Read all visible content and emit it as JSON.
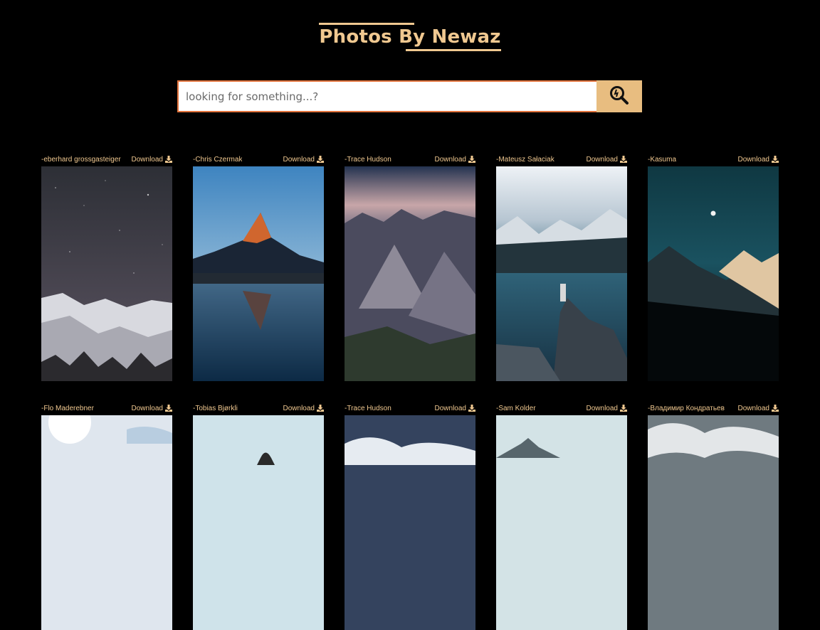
{
  "header": {
    "title": "Photos By Newaz"
  },
  "search": {
    "placeholder": "looking for something...?",
    "button_icon": "search-icon"
  },
  "photos": [
    {
      "author": "-eberhard grossgasteiger",
      "download_label": "Download"
    },
    {
      "author": "-Chris Czermak",
      "download_label": "Download"
    },
    {
      "author": "-Trace Hudson",
      "download_label": "Download"
    },
    {
      "author": "-Mateusz Sałaciak",
      "download_label": "Download"
    },
    {
      "author": "-Kasuma",
      "download_label": "Download"
    },
    {
      "author": "-Flo Maderebner",
      "download_label": "Download"
    },
    {
      "author": "-Tobias Bjørkli",
      "download_label": "Download"
    },
    {
      "author": "-Trace Hudson",
      "download_label": "Download"
    },
    {
      "author": "-Sam Kolder",
      "download_label": "Download"
    },
    {
      "author": "-Владимир Кондратьев",
      "download_label": "Download"
    }
  ],
  "colors": {
    "accent": "#e8bd80",
    "background": "#000000",
    "search_border": "#e2733c"
  }
}
